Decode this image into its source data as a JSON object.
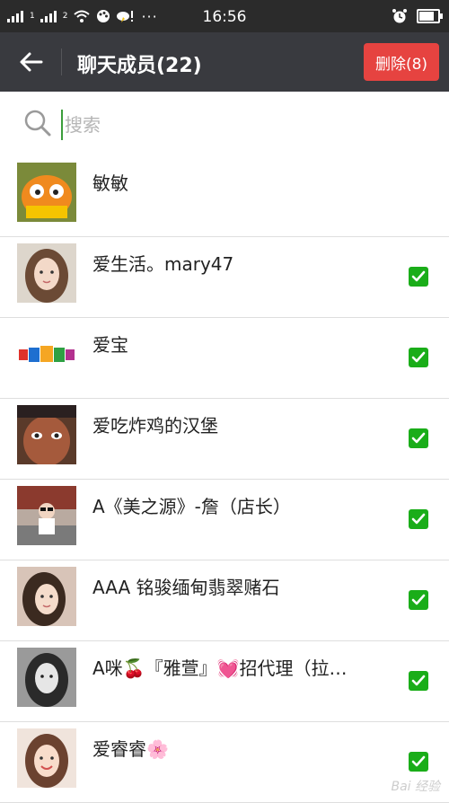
{
  "status_bar": {
    "signal_1": "1",
    "signal_2": "2",
    "time": "16:56",
    "icons": [
      "signal-icon",
      "wifi-icon",
      "palette-icon",
      "weather-alert-icon",
      "more-dots-icon",
      "alarm-icon",
      "battery-icon"
    ],
    "battery_level": 0.9
  },
  "nav": {
    "title": "聊天成员(22)",
    "delete_label": "删除(8)"
  },
  "search": {
    "placeholder": "搜索",
    "value": ""
  },
  "members": [
    {
      "name": "敏敏",
      "checked": false,
      "avatar": "garfield-avatar"
    },
    {
      "name": "爱生活。mary47",
      "checked": true,
      "avatar": "girl-avatar"
    },
    {
      "name": "爱宝",
      "checked": true,
      "avatar": "yamami-logo-avatar"
    },
    {
      "name": "爱吃炸鸡的汉堡",
      "checked": true,
      "avatar": "child-face-avatar"
    },
    {
      "name": "A《美之源》-詹（店长）",
      "checked": true,
      "avatar": "kid-avatar"
    },
    {
      "name": "AAA 铭骏缅甸翡翠赌石",
      "checked": true,
      "avatar": "woman-avatar"
    },
    {
      "name": "A咪🍒『雅萱』💓招代理（拉…",
      "checked": true,
      "avatar": "bw-girl-avatar"
    },
    {
      "name": "爱睿睿🌸",
      "checked": true,
      "avatar": "smiling-girl-avatar"
    }
  ],
  "watermark": "Bai 经验",
  "colors": {
    "status_bar": "#2b2b2b",
    "nav_bar": "#393a3f",
    "delete_button": "#e64340",
    "checkbox": "#1aad19"
  }
}
